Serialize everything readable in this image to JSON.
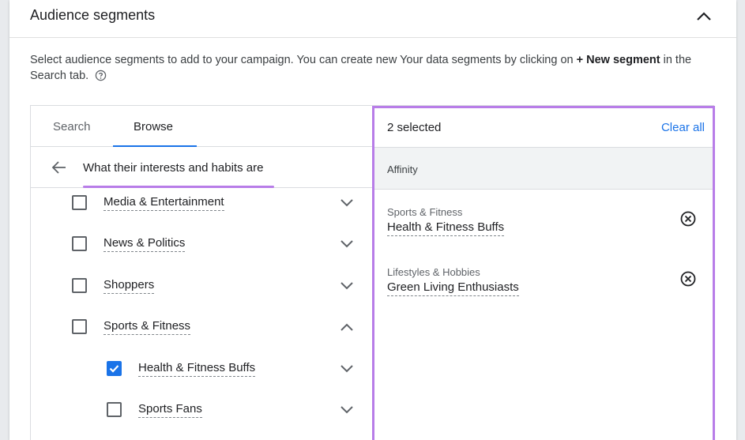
{
  "header": {
    "title": "Audience segments"
  },
  "description": {
    "text_before": "Select audience segments to add to your campaign. You can create new Your data segments by clicking on ",
    "bold": "+ New segment",
    "text_after": " in the Search tab."
  },
  "tabs": [
    {
      "label": "Search",
      "active": false
    },
    {
      "label": "Browse",
      "active": true
    }
  ],
  "breadcrumb": {
    "label": "What their interests and habits are"
  },
  "browse_items": [
    {
      "label": "Media & Entertainment",
      "checked": false,
      "expanded": false,
      "level": 0
    },
    {
      "label": "News & Politics",
      "checked": false,
      "expanded": false,
      "level": 0
    },
    {
      "label": "Shoppers",
      "checked": false,
      "expanded": false,
      "level": 0
    },
    {
      "label": "Sports & Fitness",
      "checked": false,
      "expanded": true,
      "level": 0
    },
    {
      "label": "Health & Fitness Buffs",
      "checked": true,
      "expanded": false,
      "level": 1
    },
    {
      "label": "Sports Fans",
      "checked": false,
      "expanded": false,
      "level": 1
    }
  ],
  "selection": {
    "count_label": "2 selected",
    "clear_all": "Clear all",
    "group": "Affinity",
    "items": [
      {
        "category": "Sports & Fitness",
        "name": "Health & Fitness Buffs"
      },
      {
        "category": "Lifestyles & Hobbies",
        "name": "Green Living Enthusiasts"
      }
    ]
  },
  "colors": {
    "accent": "#1a73e8",
    "highlight": "#b87de8",
    "text": "#202124"
  }
}
